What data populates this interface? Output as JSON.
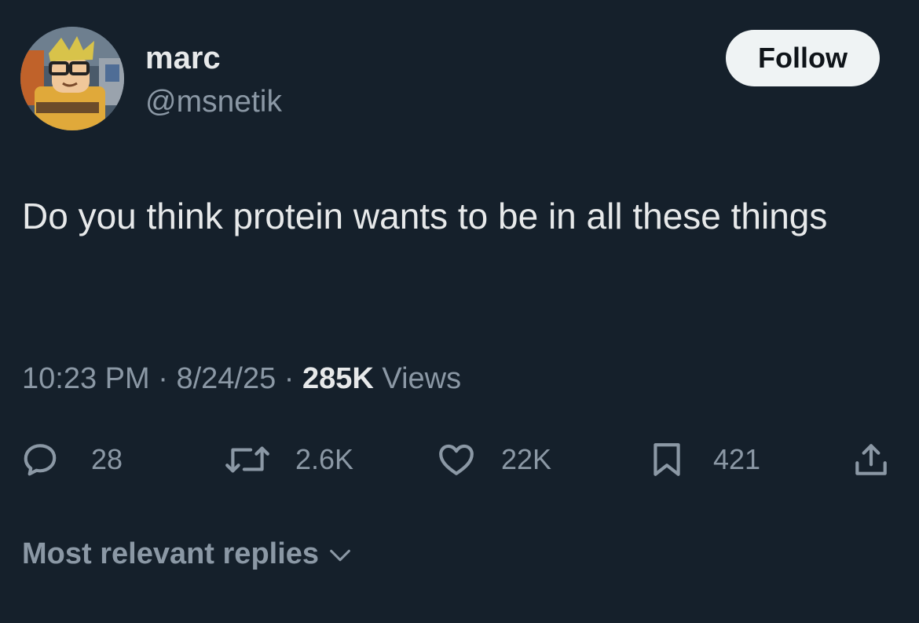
{
  "author": {
    "display_name": "marc",
    "handle": "@msnetik"
  },
  "follow_button": {
    "label": "Follow"
  },
  "tweet": {
    "text": "Do you think protein wants to be in all these things"
  },
  "meta": {
    "time": "10:23 PM",
    "separator": "·",
    "date": "8/24/25",
    "views_count": "285K",
    "views_label": "Views"
  },
  "actions": {
    "replies": "28",
    "reposts": "2.6K",
    "likes": "22K",
    "bookmarks": "421"
  },
  "replies_sort": {
    "label": "Most relevant replies"
  },
  "icons": {
    "reply": "reply-icon",
    "repost": "repost-icon",
    "like": "heart-icon",
    "bookmark": "bookmark-icon",
    "share": "share-icon",
    "chevron": "chevron-down-icon"
  },
  "colors": {
    "background": "#15202b",
    "primary_text": "#e7e9ea",
    "secondary_text": "#8b98a5",
    "button_bg": "#eff3f4",
    "button_text": "#0f1419"
  }
}
